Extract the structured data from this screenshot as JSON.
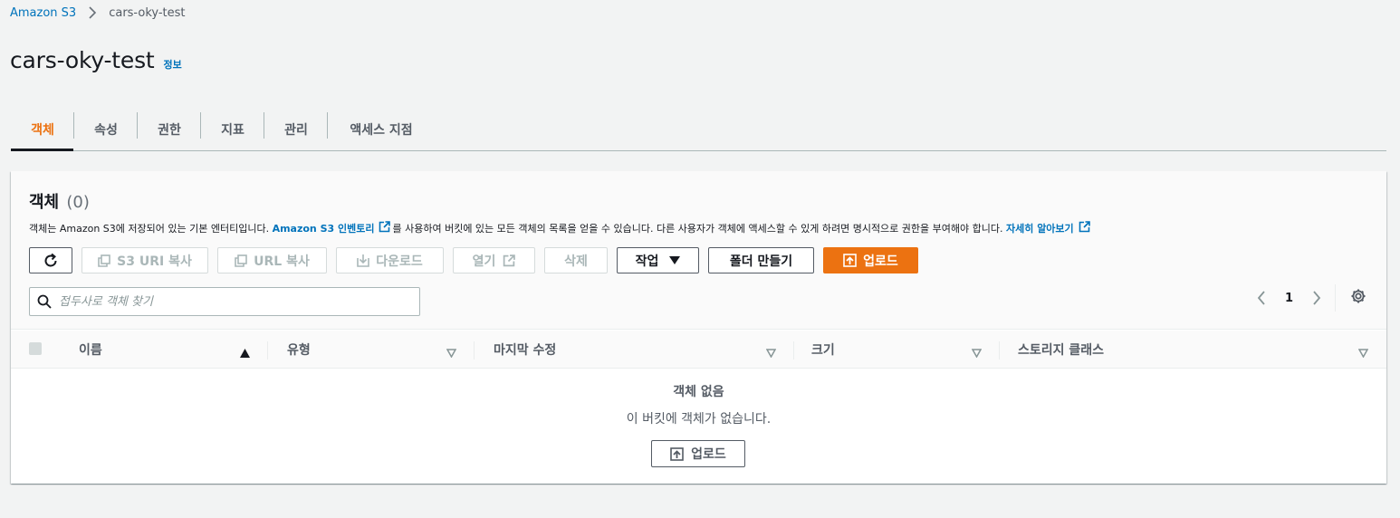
{
  "breadcrumb": {
    "root": "Amazon S3",
    "current": "cars-oky-test"
  },
  "header": {
    "title": "cars-oky-test",
    "info": "정보"
  },
  "tabs": [
    {
      "label": "객체",
      "active": true
    },
    {
      "label": "속성",
      "active": false
    },
    {
      "label": "권한",
      "active": false
    },
    {
      "label": "지표",
      "active": false
    },
    {
      "label": "관리",
      "active": false
    },
    {
      "label": "액세스 지점",
      "active": false
    }
  ],
  "objects": {
    "title": "객체",
    "count": "(0)",
    "desc_part1": "객체는 Amazon S3에 저장되어 있는 기본 엔터티입니다.",
    "inventory_link": "Amazon S3 인벤토리",
    "desc_part2": "를 사용하여 버킷에 있는 모든 객체의 목록을 얻을 수 있습니다. 다른 사용자가 객체에 액세스할 수 있게 하려면 명시적으로 권한을 부여해야 합니다.",
    "learn_more": "자세히 알아보기"
  },
  "toolbar": {
    "copy_s3_uri": "S3 URI 복사",
    "copy_url": "URL 복사",
    "download": "다운로드",
    "open": "열기",
    "delete": "삭제",
    "actions": "작업",
    "create_folder": "폴더 만들기",
    "upload": "업로드"
  },
  "search": {
    "placeholder": "접두사로 객체 찾기"
  },
  "pagination": {
    "page": "1"
  },
  "table": {
    "columns": [
      "이름",
      "유형",
      "마지막 수정",
      "크기",
      "스토리지 클래스"
    ]
  },
  "empty": {
    "title": "객체 없음",
    "desc": "이 버킷에 객체가 없습니다.",
    "upload": "업로드"
  },
  "colors": {
    "accent": "#ec7211",
    "link": "#0073bb"
  }
}
